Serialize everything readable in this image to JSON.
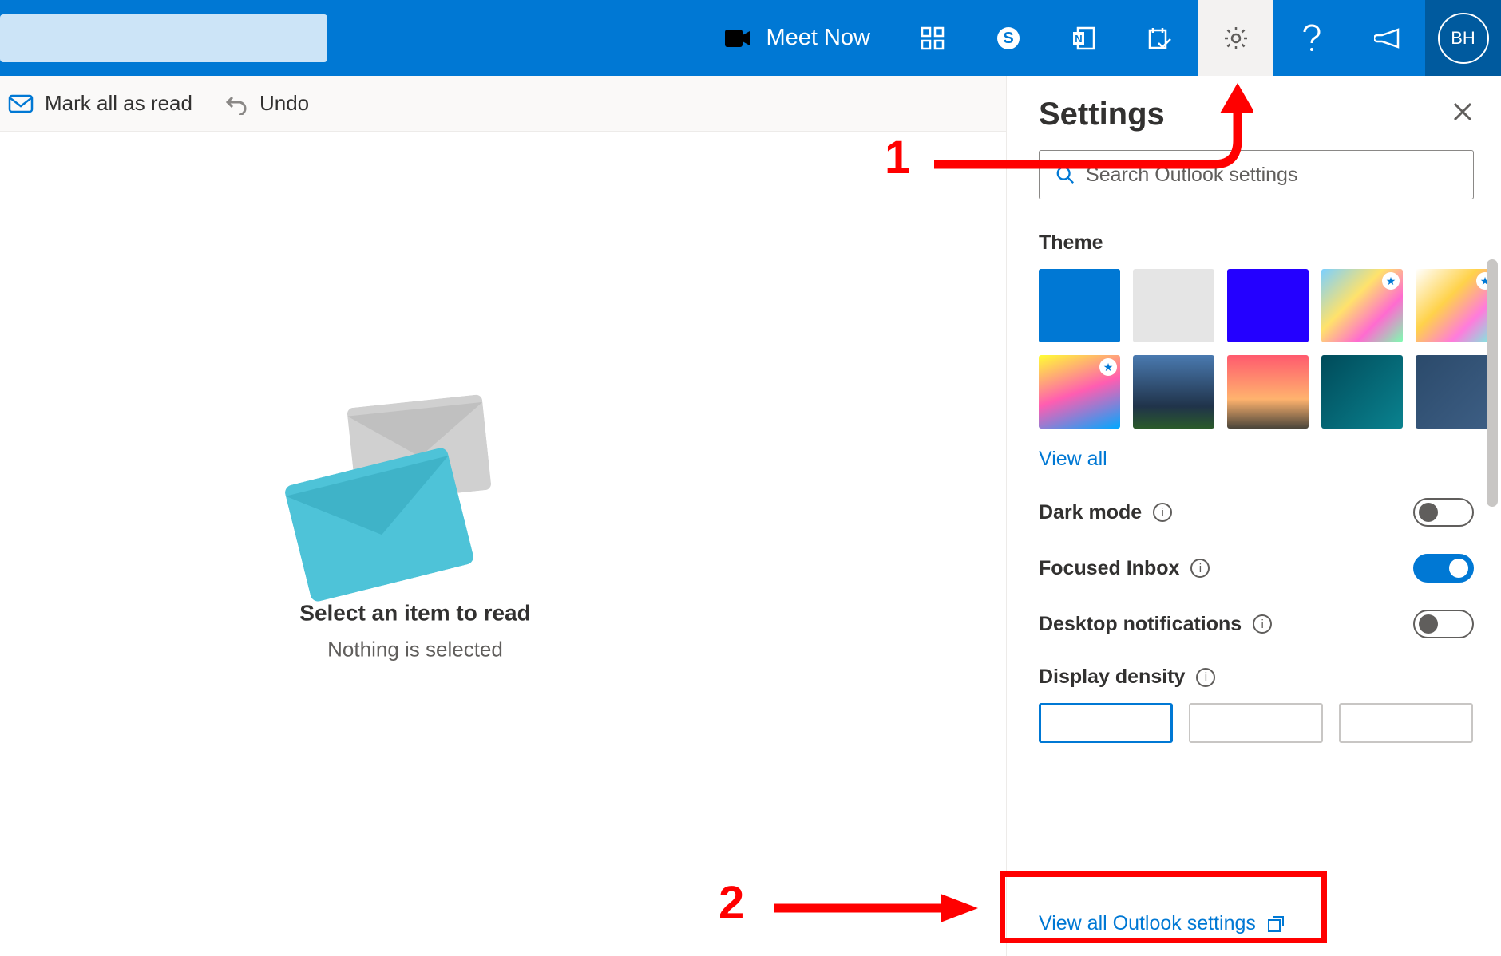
{
  "topbar": {
    "meet_now_label": "Meet Now",
    "avatar_initials": "BH"
  },
  "actionbar": {
    "mark_all_read_label": "Mark all as read",
    "undo_label": "Undo"
  },
  "empty_state": {
    "title": "Select an item to read",
    "subtitle": "Nothing is selected"
  },
  "settings": {
    "title": "Settings",
    "search_placeholder": "Search Outlook settings",
    "theme_label": "Theme",
    "view_all_label": "View all",
    "dark_mode_label": "Dark mode",
    "focused_inbox_label": "Focused Inbox",
    "desktop_notifications_label": "Desktop notifications",
    "display_density_label": "Display density",
    "view_all_settings_label": "View all Outlook settings"
  },
  "annotations": {
    "step1": "1",
    "step2": "2"
  }
}
